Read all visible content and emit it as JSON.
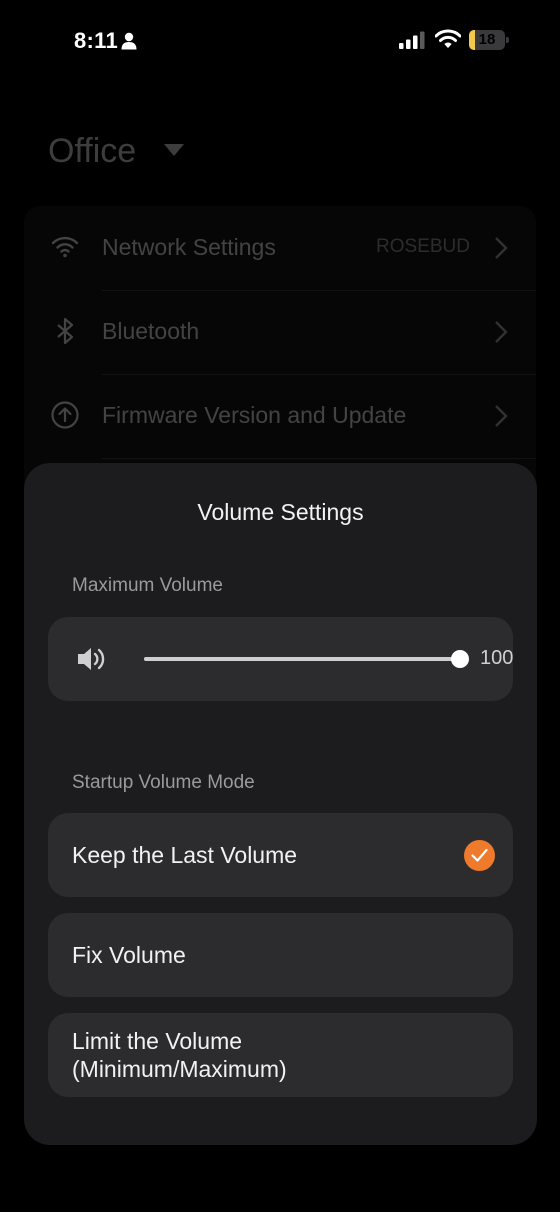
{
  "status_bar": {
    "time": "8:11",
    "battery_level": "18",
    "battery_fraction": 0.18,
    "icons": [
      "person-icon",
      "signal-icon",
      "wifi-icon",
      "battery-icon"
    ]
  },
  "background": {
    "room_title": "Office",
    "rows": [
      {
        "label": "Network Settings",
        "value": "ROSEBUD",
        "icon": "wifi-icon"
      },
      {
        "label": "Bluetooth",
        "value": "",
        "icon": "bluetooth-icon"
      },
      {
        "label": "Firmware Version and Update",
        "value": "",
        "icon": "upgrade-icon"
      }
    ]
  },
  "sheet": {
    "title": "Volume Settings",
    "max_volume": {
      "label": "Maximum Volume",
      "value": "100",
      "level": 1.0
    },
    "startup_mode": {
      "label": "Startup Volume Mode",
      "options": [
        {
          "label": "Keep the Last Volume",
          "selected": true
        },
        {
          "label": "Fix Volume",
          "selected": false
        },
        {
          "label": "Limit the Volume\n(Minimum/Maximum)",
          "selected": false
        }
      ]
    }
  },
  "colors": {
    "accent": "#f07a2c",
    "sheet_bg": "#1c1c1e",
    "card_bg": "#2c2c2e",
    "battery": "#f2c94c"
  }
}
